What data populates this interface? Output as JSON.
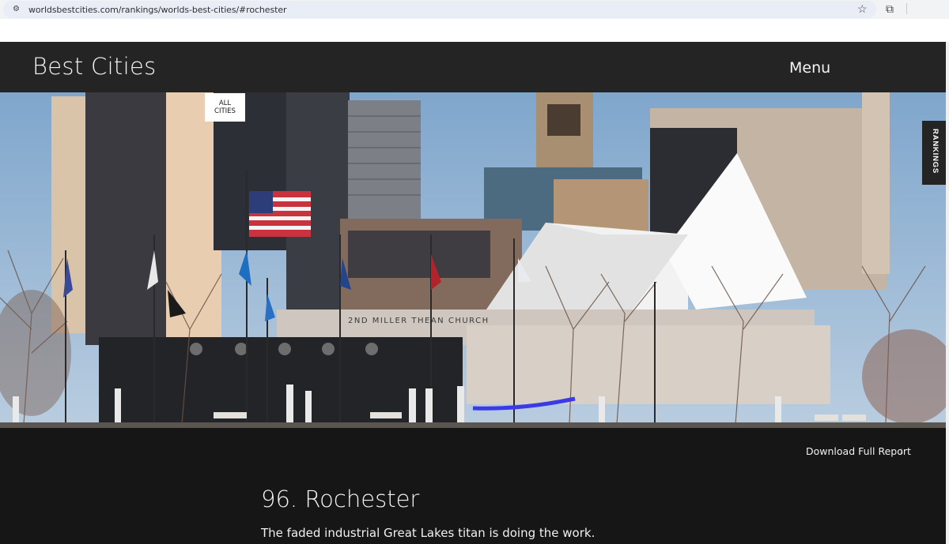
{
  "browser": {
    "url": "worldsbestcities.com/rankings/worlds-best-cities/#rochester",
    "site_icon": "tune-icon",
    "bookmark_icon": "star-icon",
    "extensions_icon": "puzzle-icon"
  },
  "header": {
    "brand": "Best Cities",
    "menu_label": "Menu"
  },
  "hero": {
    "all_cities_line1": "ALL",
    "all_cities_line2": "CITIES",
    "rankings_tab": "RANKINGS",
    "building_sign": "2ND MILLER THEAN CHURCH",
    "image_subject": "Rochester skyline with flags and a white pyramid-roofed church"
  },
  "content": {
    "download_label": "Download Full Report",
    "download_icon": "arrow-down-icon",
    "city_title": "96. Rochester",
    "tagline": "The faded industrial Great Lakes titan is doing the work."
  },
  "colors": {
    "header_bg": "#242424",
    "page_bg": "#161616",
    "text": "#f4f4f4"
  }
}
